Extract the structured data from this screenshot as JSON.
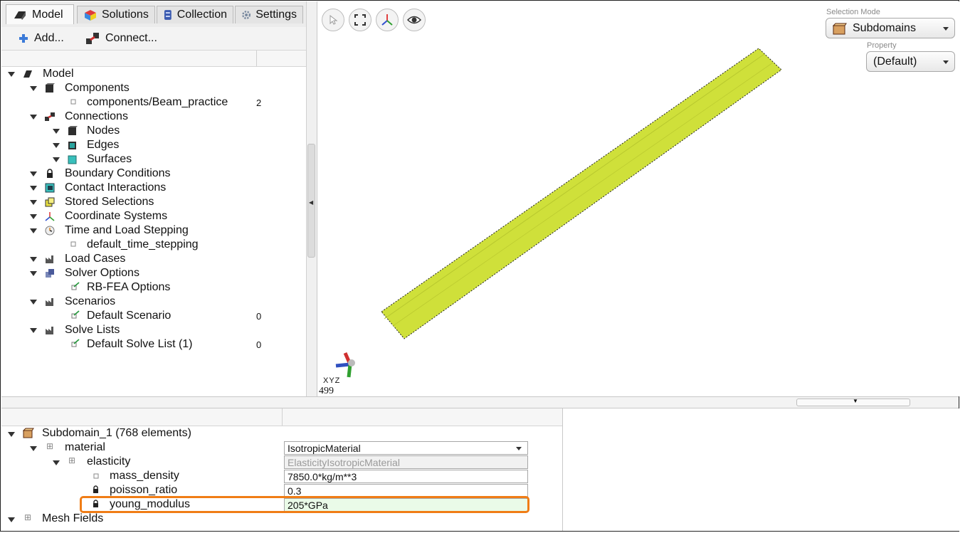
{
  "tabs": [
    {
      "label": "Model",
      "icon": "model-icon"
    },
    {
      "label": "Solutions",
      "icon": "solutions-icon"
    },
    {
      "label": "Collection",
      "icon": "collection-icon"
    },
    {
      "label": "Settings",
      "icon": "gear-icon"
    }
  ],
  "toolbar": {
    "add_label": "Add...",
    "connect_label": "Connect..."
  },
  "tree": [
    {
      "label": "Model",
      "count": ""
    },
    {
      "label": "Components",
      "count": ""
    },
    {
      "label": "components/Beam_practice",
      "count": "2"
    },
    {
      "label": "Connections",
      "count": ""
    },
    {
      "label": "Nodes",
      "count": ""
    },
    {
      "label": "Edges",
      "count": ""
    },
    {
      "label": "Surfaces",
      "count": ""
    },
    {
      "label": "Boundary Conditions",
      "count": ""
    },
    {
      "label": "Contact Interactions",
      "count": ""
    },
    {
      "label": "Stored Selections",
      "count": ""
    },
    {
      "label": "Coordinate Systems",
      "count": ""
    },
    {
      "label": "Time and Load Stepping",
      "count": ""
    },
    {
      "label": "default_time_stepping",
      "count": ""
    },
    {
      "label": "Load Cases",
      "count": ""
    },
    {
      "label": "Solver Options",
      "count": ""
    },
    {
      "label": "RB-FEA Options",
      "count": ""
    },
    {
      "label": "Scenarios",
      "count": ""
    },
    {
      "label": "Default Scenario",
      "count": "0"
    },
    {
      "label": "Solve Lists",
      "count": ""
    },
    {
      "label": "Default Solve List (1)",
      "count": "0"
    }
  ],
  "viewport": {
    "selection_mode_label": "Selection Mode",
    "selection_mode_value": "Subdomains",
    "property_label": "Property",
    "property_value": "(Default)",
    "axes_label": "XYZ",
    "frame_number": "499",
    "beam_color": "#cfe03a"
  },
  "properties": {
    "subdomain": "Subdomain_1 (768 elements)",
    "rows": [
      {
        "label": "material",
        "value": "IsotropicMaterial"
      },
      {
        "label": "elasticity",
        "value": "ElasticityIsotropicMaterial"
      },
      {
        "label": "mass_density",
        "value": "7850.0*kg/m**3"
      },
      {
        "label": "poisson_ratio",
        "value": "0.3"
      },
      {
        "label": "young_modulus",
        "value": "205*GPa"
      }
    ],
    "mesh_fields": "Mesh Fields"
  },
  "colors": {
    "highlight": "#f07d16",
    "field_highlight": "#eafbe8"
  }
}
